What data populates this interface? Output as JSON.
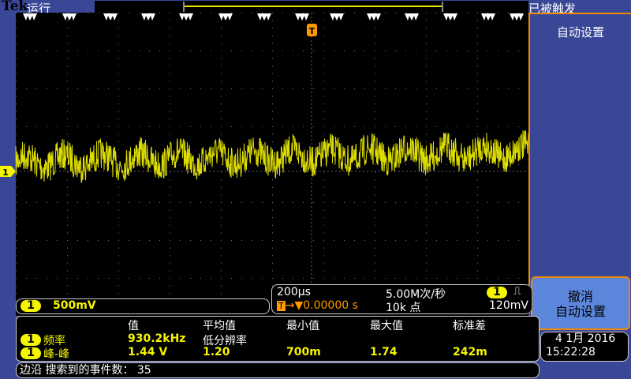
{
  "header": {
    "brand": "Tek",
    "run_state": "运行",
    "trigger_state": "已被触发"
  },
  "side_menu": {
    "title": "自动设置",
    "cancel_line1": "撤消",
    "cancel_line2": "自动设置"
  },
  "channel": {
    "number": "1",
    "scale": "500mV"
  },
  "horizontal": {
    "timebase": "200µs",
    "sample_rate": "5.00M次/秒",
    "trigger_pos": "0.00000 s",
    "record_length": "10k 点",
    "trigger_channel": "1",
    "trigger_level": "120mV"
  },
  "measurements": {
    "headers": [
      "值",
      "平均值",
      "最小值",
      "最大值",
      "标准差"
    ],
    "rows": [
      {
        "channel": "1",
        "name": "频率",
        "value": "930.2kHz",
        "mean": "低分辨率"
      },
      {
        "channel": "1",
        "name": "峰-峰",
        "value": "1.44 V",
        "mean": "1.20",
        "min": "700m",
        "max": "1.74",
        "std": "242m"
      }
    ]
  },
  "status": {
    "text": "边沿 搜索到的事件数： 35"
  },
  "datetime": {
    "date": "4 1月 2016",
    "time": "15:22:28"
  },
  "colors": {
    "trace": "#f5f500",
    "trigger": "#ff9a00",
    "background": "#3a4796"
  }
}
